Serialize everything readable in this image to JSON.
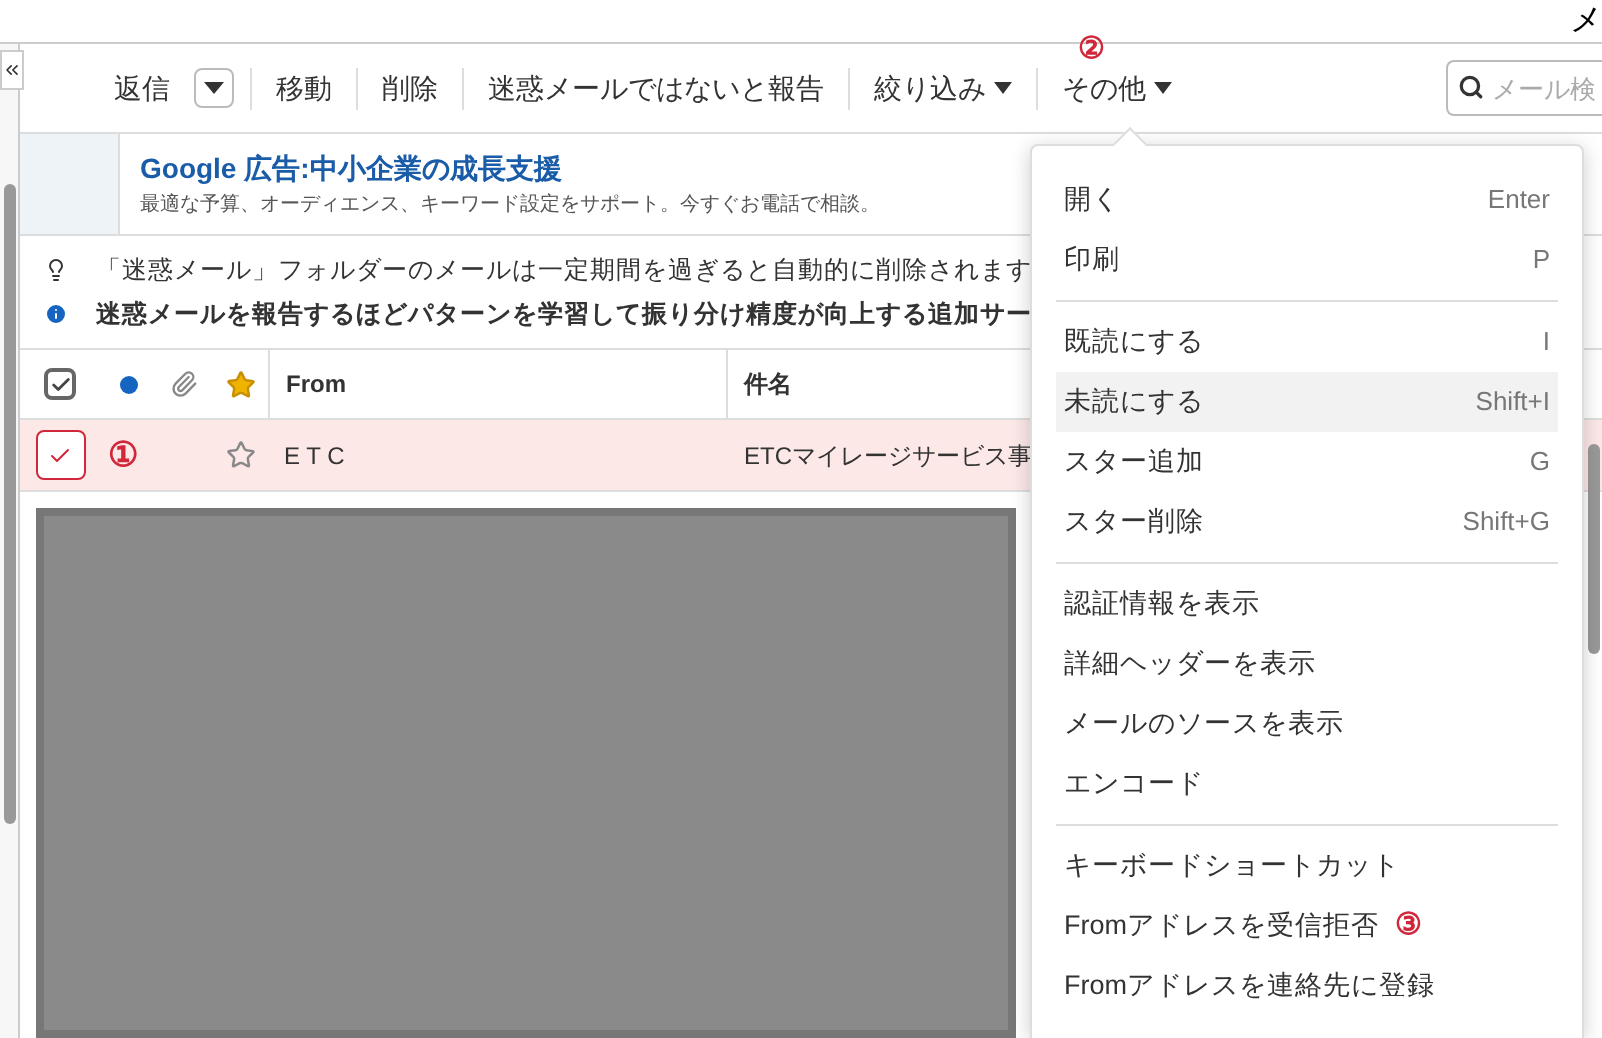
{
  "header": {
    "title_fragment": "メ"
  },
  "toolbar": {
    "buttons": [
      {
        "kind": "split",
        "label": "返信"
      },
      {
        "kind": "plain",
        "label": "移動"
      },
      {
        "kind": "plain",
        "label": "削除"
      },
      {
        "kind": "plain",
        "label": "迷惑メールではないと報告"
      },
      {
        "kind": "menu",
        "label": "絞り込み"
      },
      {
        "kind": "menu",
        "label": "その他",
        "annotation": "②"
      }
    ],
    "search": {
      "placeholder": "メール検"
    }
  },
  "ad": {
    "title": "Google 広告:中小企業の成長支援",
    "text": "最適な予算、オーディエンス、キーワード設定をサポート。今すぐお電話で相談。"
  },
  "notices": [
    {
      "kind": "tip",
      "text": "「迷惑メール」フォルダーのメールは一定期間を過ぎると自動的に削除されます"
    },
    {
      "kind": "info",
      "text": "迷惑メールを報告するほどパターンを学習して振り分け精度が向上する追加サー"
    }
  ],
  "table": {
    "columns": [
      {
        "kind": "checkbox",
        "checked": true
      },
      {
        "kind": "unread"
      },
      {
        "kind": "attachment"
      },
      {
        "kind": "star"
      },
      {
        "kind": "text",
        "label": "From"
      },
      {
        "kind": "text",
        "label": "件名"
      }
    ],
    "rows": [
      {
        "selected": true,
        "checked": true,
        "annotation": "①",
        "starred": false,
        "from": "E T C",
        "subject": "ETCマイレージサービス事"
      }
    ]
  },
  "menu": {
    "sections": [
      [
        {
          "label": "開く",
          "shortcut": "Enter",
          "selected": false
        },
        {
          "label": "印刷",
          "shortcut": "P",
          "selected": false
        }
      ],
      [
        {
          "label": "既読にする",
          "shortcut": "I",
          "selected": false
        },
        {
          "label": "未読にする",
          "shortcut": "Shift+I",
          "selected": true
        },
        {
          "label": "スター追加",
          "shortcut": "G",
          "selected": false
        },
        {
          "label": "スター削除",
          "shortcut": "Shift+G",
          "selected": false
        }
      ],
      [
        {
          "label": "認証情報を表示",
          "selected": false
        },
        {
          "label": "詳細ヘッダーを表示",
          "selected": false
        },
        {
          "label": "メールのソースを表示",
          "selected": false
        },
        {
          "label": "エンコード",
          "selected": false
        }
      ],
      [
        {
          "label": "キーボードショートカット",
          "selected": false
        },
        {
          "label": "Fromアドレスを受信拒否",
          "annotation": "③",
          "selected": false
        },
        {
          "label": "Fromアドレスを連絡先に登録",
          "selected": false
        }
      ]
    ]
  }
}
